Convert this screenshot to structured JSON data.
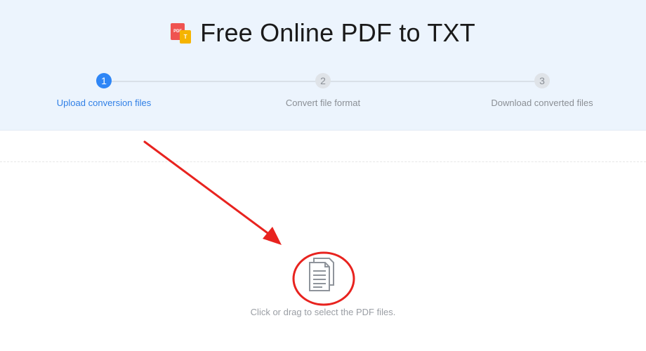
{
  "header": {
    "logo_pdf_text": "PDF",
    "logo_txt_text": "T",
    "title": "Free Online PDF to TXT"
  },
  "steps": [
    {
      "number": "1",
      "label": "Upload conversion files",
      "state": "active"
    },
    {
      "number": "2",
      "label": "Convert file format",
      "state": "inactive"
    },
    {
      "number": "3",
      "label": "Download converted files",
      "state": "inactive"
    }
  ],
  "upload": {
    "hint": "Click or drag to select the PDF files.",
    "icon": "documents-icon"
  },
  "colors": {
    "accent": "#2f86f6",
    "hero_background": "#ecf4fd",
    "annotation_red": "#e8231f",
    "logo_pdf": "#ef5350",
    "logo_txt": "#f5b400"
  }
}
